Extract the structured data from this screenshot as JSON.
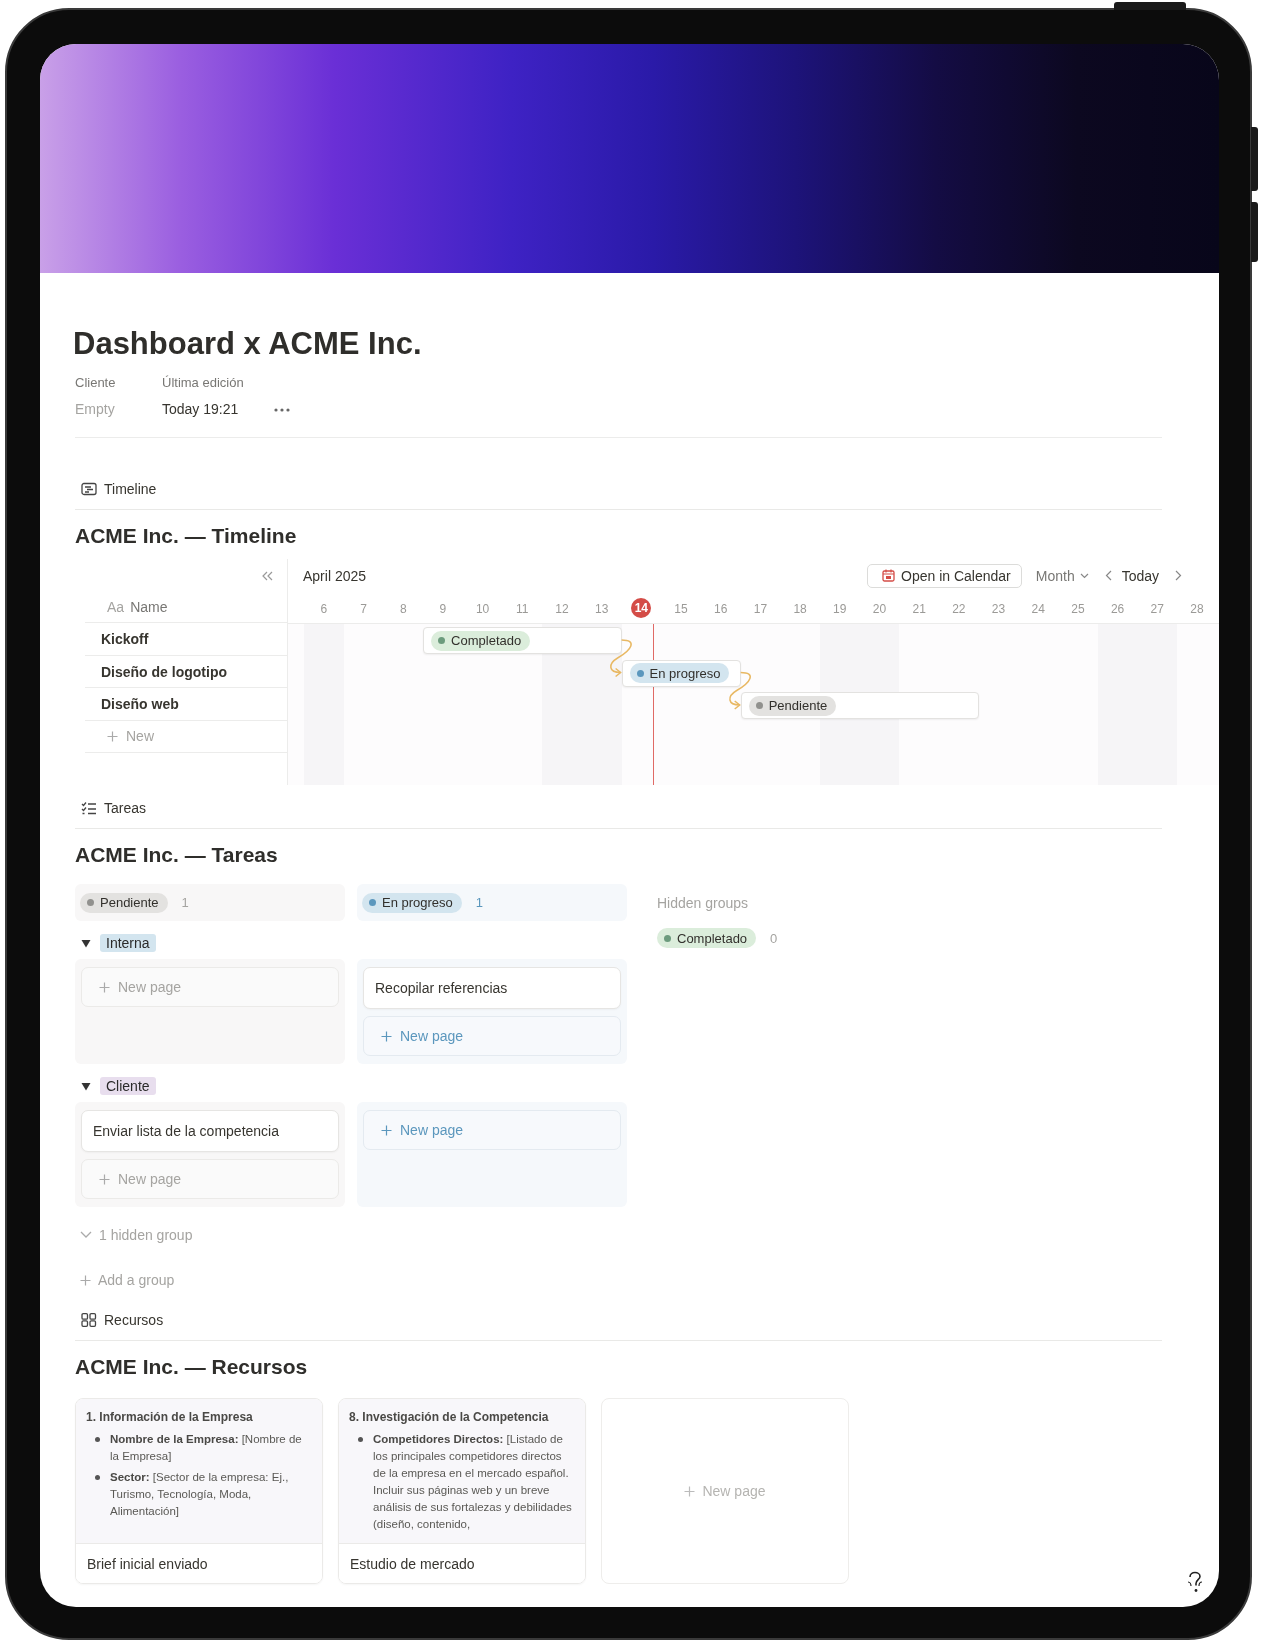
{
  "page": {
    "title": "Dashboard x ACME Inc.",
    "properties": [
      {
        "label": "Cliente",
        "value": "Empty",
        "empty": true
      },
      {
        "label": "Última edición",
        "value": "Today 19:21",
        "empty": false
      }
    ]
  },
  "timeline": {
    "view_label": "Timeline",
    "heading": "ACME Inc. — Timeline",
    "name_prefix": "Aa",
    "name_column": "Name",
    "month": "April 2025",
    "open_calendar": "Open in Calendar",
    "scale": "Month",
    "today_button": "Today",
    "days": [
      {
        "label": "6",
        "weekend": true,
        "today": false
      },
      {
        "label": "7",
        "weekend": false,
        "today": false
      },
      {
        "label": "8",
        "weekend": false,
        "today": false
      },
      {
        "label": "9",
        "weekend": false,
        "today": false
      },
      {
        "label": "10",
        "weekend": false,
        "today": false
      },
      {
        "label": "11",
        "weekend": false,
        "today": false
      },
      {
        "label": "12",
        "weekend": true,
        "today": false
      },
      {
        "label": "13",
        "weekend": true,
        "today": false
      },
      {
        "label": "14",
        "weekend": false,
        "today": true
      },
      {
        "label": "15",
        "weekend": false,
        "today": false
      },
      {
        "label": "16",
        "weekend": false,
        "today": false
      },
      {
        "label": "17",
        "weekend": false,
        "today": false
      },
      {
        "label": "18",
        "weekend": false,
        "today": false
      },
      {
        "label": "19",
        "weekend": true,
        "today": false
      },
      {
        "label": "20",
        "weekend": true,
        "today": false
      },
      {
        "label": "21",
        "weekend": false,
        "today": false
      },
      {
        "label": "22",
        "weekend": false,
        "today": false
      },
      {
        "label": "23",
        "weekend": false,
        "today": false
      },
      {
        "label": "24",
        "weekend": false,
        "today": false
      },
      {
        "label": "25",
        "weekend": false,
        "today": false
      },
      {
        "label": "26",
        "weekend": true,
        "today": false
      },
      {
        "label": "27",
        "weekend": true,
        "today": false
      },
      {
        "label": "28",
        "weekend": false,
        "today": false
      }
    ],
    "rows": [
      {
        "name": "Kickoff",
        "status": "Completado",
        "kind": "done",
        "color": "#6c9b7d",
        "arrow_to_next": true
      },
      {
        "name": "Diseño de logotipo",
        "status": "En progreso",
        "kind": "progress",
        "color": "#5b97bd",
        "arrow_to_next": true
      },
      {
        "name": "Diseño web",
        "status": "Pendiente",
        "kind": "pending",
        "color": "#91918e",
        "arrow_to_next": false
      }
    ],
    "new_row": "New"
  },
  "tareas": {
    "view_label": "Tareas",
    "heading": "ACME Inc. — Tareas",
    "columns": [
      {
        "status": "Pendiente",
        "kind": "pending",
        "color": "#91918e",
        "count": "1"
      },
      {
        "status": "En progreso",
        "kind": "progress",
        "color": "#5b97bd",
        "count": "1"
      }
    ],
    "hidden_label": "Hidden groups",
    "hidden": [
      {
        "status": "Completado",
        "kind": "done",
        "color": "#6c9b7d",
        "count": "0"
      }
    ],
    "groups": [
      {
        "name": "Interna",
        "color": "#d3e5ef",
        "expanded": true,
        "cells": [
          {
            "new_page": "New page"
          },
          {
            "cards": [
              "Recopilar referencias"
            ],
            "new_page": "New page"
          }
        ]
      },
      {
        "name": "Cliente",
        "color": "#e8deee",
        "expanded": true,
        "cells": [
          {
            "cards": [
              "Enviar lista de la competencia"
            ],
            "new_page": "New page"
          },
          {
            "new_page": "New page"
          }
        ]
      }
    ],
    "hidden_groups_toggle": "1 hidden group",
    "add_group": "Add a group"
  },
  "recursos": {
    "view_label": "Recursos",
    "heading": "ACME Inc. — Recursos",
    "cards": [
      {
        "preview_heading": "1. Información de la Empresa",
        "bullets": [
          "**Nombre de la Empresa:** [Nombre de la Empresa]",
          "**Sector:** [Sector de la empresa: Ej., Turismo, Tecnología, Moda, Alimentación]"
        ],
        "title": "Brief inicial enviado"
      },
      {
        "preview_heading": "8. Investigación de la Competencia",
        "bullets": [
          "**Competidores Directos:** [Listado de los principales competidores directos de la empresa en el mercado español. Incluir sus páginas web y un breve análisis de sus fortalezas y debilidades (diseño, contenido,"
        ],
        "title": "Estudio de mercado"
      }
    ],
    "new_page": "New page"
  }
}
